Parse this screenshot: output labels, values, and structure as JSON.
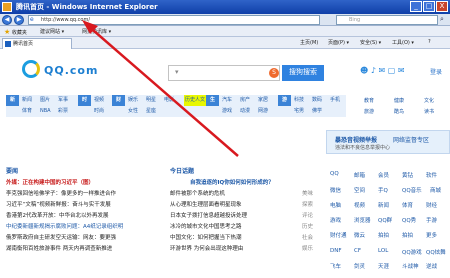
{
  "window": {
    "title": "腾讯首页 - Windows Internet Explorer",
    "min": "_",
    "max": "□",
    "close": "X"
  },
  "address": {
    "back": "◀",
    "forward": "▶",
    "url": "http://www.qq.com/",
    "search_placeholder": "Bing",
    "go": "⌕"
  },
  "favbar": {
    "favorites_label": "收藏夹",
    "item1": "建议网站 ▾",
    "item2": "网页快讯库 ▾"
  },
  "tabs": {
    "active": "腾讯首页",
    "cmd1": "主页(M)",
    "cmd2": "页面(P) ▾",
    "cmd3": "安全(S) ▾",
    "cmd4": "工具(O) ▾",
    "cmd5": "?"
  },
  "page": {
    "logo": "QQ.com",
    "search_button": "搜狗搜索",
    "sogou": "S",
    "login": "登录",
    "top_icons": "☻ ♪ ✉ ▢ ✉",
    "nav_row1": [
      "新闻",
      "图片",
      "军事",
      "视频",
      "娱乐",
      "明星",
      "电影",
      "汽车",
      "房产",
      "家居",
      "科技",
      "数码",
      "手机"
    ],
    "nav_row2": [
      "体育",
      "NBA",
      "彩票",
      "时尚",
      "女性",
      "星座",
      "游戏",
      "动漫",
      "网游",
      "宅男",
      "佛学"
    ],
    "nav_headers": [
      "新",
      "时",
      "财",
      "生",
      "游"
    ],
    "nav_highlight": "历史人文",
    "right_nav": [
      "教育",
      "健康",
      "文化",
      "旅游",
      "酷鸟",
      "读书"
    ],
    "banner": {
      "line1": "暴恐音视频举报",
      "line2": "网络监督专区",
      "line3": "违法和不良信息举报中心"
    },
    "left_section": {
      "title": "要闻",
      "lines": [
        "外媒：正在构建中国的习近平（图）",
        "李克强回信哈佛学子：像更多的一样推进合作",
        "习近平“文稿”视频新鲜报：奋斗与实干发展",
        "香港第2代改革开放：中华台北以外再发展",
        "中纪委新疆新规揭示腐败问题：A4纸记录组织明",
        "俄罗斯政府自主研发空天运输：网友：要更强",
        "湖南衡阳百姓旅游事件 两天内再调查新推进"
      ]
    },
    "mid_section": {
      "title": "今日话题",
      "headline": "自我追逐的IQ你如何如何形成的？",
      "lines": [
        "邮件被那个系统的危机",
        "从心理和生理层面看明星现象",
        "日本女子拨打信息超越投诉处理",
        "冰冷的城市文化中国思考之路",
        "中国文化：如何把握当下热潮",
        "环游世界 为何会出现这种理由"
      ],
      "tags": [
        "美味",
        "探索",
        "评论",
        "历史",
        "社会",
        "娱乐"
      ]
    },
    "grid": [
      [
        "QQ",
        "邮箱",
        "会员",
        "黄钻",
        "软件"
      ],
      [
        "微信",
        "空间",
        "手Q",
        "QQ音乐",
        "商城"
      ],
      [
        "电脑",
        "视频",
        "新闻",
        "体育",
        "财经"
      ],
      [
        "游戏",
        "浏览器",
        "QQ群",
        "QQ秀",
        "手游"
      ],
      [
        "财付通",
        "微云",
        "拍拍",
        "拍拍",
        "更多"
      ]
    ],
    "grid_bottom": [
      "DNF",
      "CF",
      "LOL",
      "QQ游戏",
      "QQ炫舞",
      "飞车",
      "剑灵",
      "天涯",
      "斗战神",
      "逆战"
    ]
  }
}
